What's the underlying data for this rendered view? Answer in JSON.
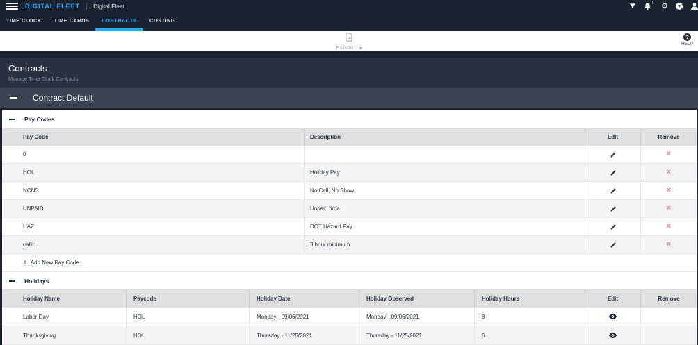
{
  "topbar": {
    "brand": "DIGITAL FLEET",
    "app_title": "Digital Fleet",
    "notification_count": "0",
    "icons": {
      "menu": "hamburger",
      "filter": "funnel",
      "notifications": "bell",
      "settings": "gear",
      "help": "question-circle",
      "account": "person"
    }
  },
  "tabs": [
    "TIME CLOCK",
    "TIME CARDS",
    "CONTRACTS",
    "COSTING"
  ],
  "active_tab": "CONTRACTS",
  "toolbar": {
    "export_label": "EXPORT",
    "help_label": "HELP",
    "help_glyph": "?",
    "top_help_glyph": "?"
  },
  "page": {
    "title": "Contracts",
    "subtitle": "Manage Time Clock Contracts"
  },
  "contract": {
    "name": "Contract Default"
  },
  "pay_codes": {
    "section_title": "Pay Codes",
    "columns": [
      "Pay Code",
      "Description",
      "Edit",
      "Remove"
    ],
    "rows": [
      {
        "code": "0",
        "description": ""
      },
      {
        "code": "HOL",
        "description": "Holiday Pay"
      },
      {
        "code": "NCNS",
        "description": "No Call, No Show"
      },
      {
        "code": "UNPAID",
        "description": "Unpaid time"
      },
      {
        "code": "HAZ",
        "description": "DOT Hazard Pay"
      },
      {
        "code": "callin",
        "description": "3 hour minimum"
      }
    ],
    "remove_glyph": "×",
    "add_icon": "+",
    "add_label": "Add New Pay Code"
  },
  "holidays": {
    "section_title": "Holidays",
    "columns": [
      "Holiday Name",
      "Paycode",
      "Holiday Date",
      "Holiday Observed",
      "Holiday Hours",
      "Edit",
      "Remove"
    ],
    "rows": [
      {
        "name": "Labor Day",
        "paycode": "HOL",
        "date": "Monday - 09/06/2021",
        "observed": "Monday - 09/06/2021",
        "hours": "8"
      },
      {
        "name": "Thanksgiving",
        "paycode": "HOL",
        "date": "Thursday - 11/25/2021",
        "observed": "Thursday - 11/25/2021",
        "hours": "6"
      }
    ]
  },
  "colors": {
    "topbar": "#1b2330",
    "accent": "#2baaf2",
    "page_header": "#2a3240",
    "contract_bar": "#3a4350",
    "table_header": "#e0e0e0",
    "remove": "#e57f8c"
  }
}
